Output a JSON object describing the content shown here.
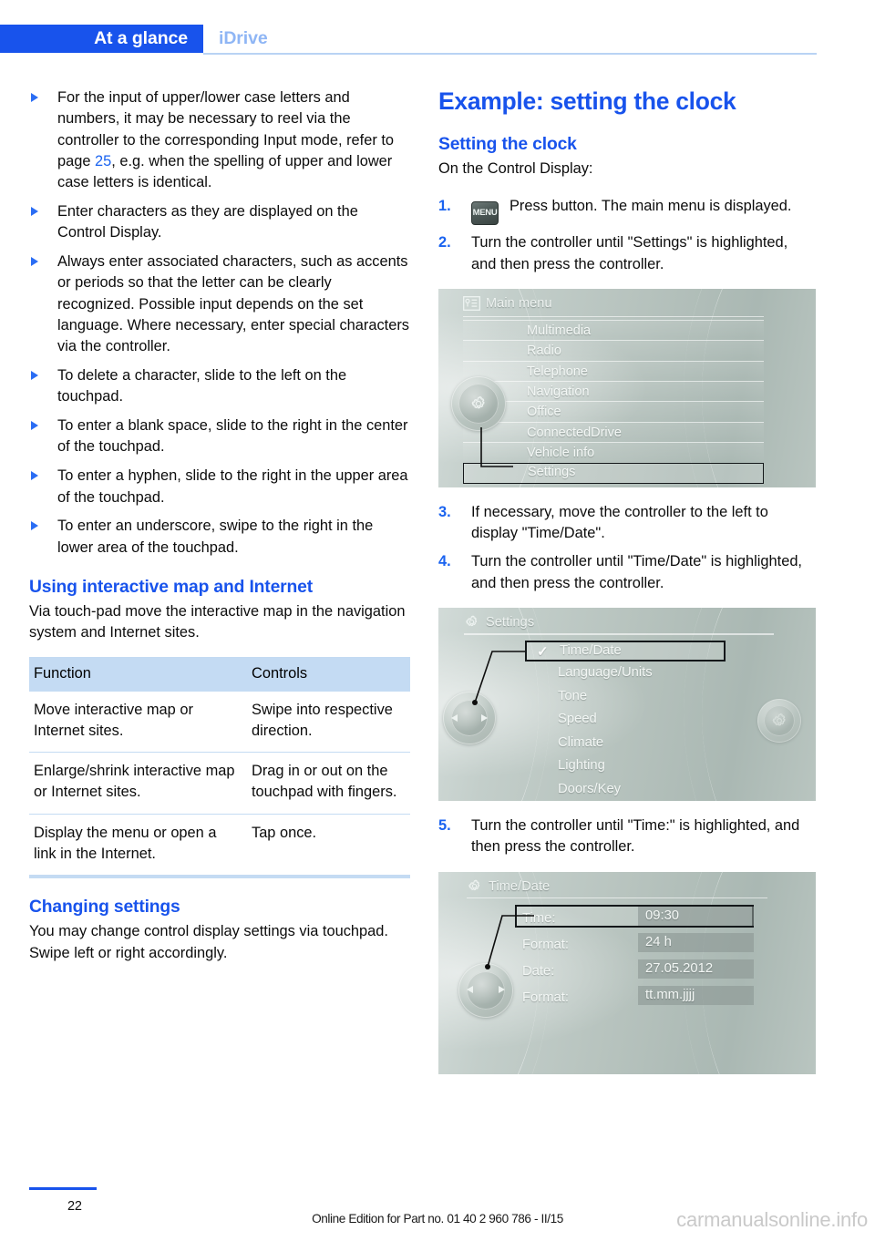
{
  "header": {
    "tab_label": "At a glance",
    "section_label": "iDrive",
    "accent_color": "#1853ec",
    "sub_color": "#8fb6f5"
  },
  "left_column": {
    "bullets": [
      {
        "text_before": "For the input of upper/lower case letters and numbers, it may be necessary to reel via the controller to the corresponding Input mode, refer to page ",
        "page_ref": "25",
        "text_after": ", e.g. when the spelling of upper and lower case letters is identical."
      },
      {
        "text_before": "Enter characters as they are displayed on the Control Display.",
        "page_ref": "",
        "text_after": ""
      },
      {
        "text_before": "Always enter associated characters, such as accents or periods so that the letter can be clearly recognized. Possible input depends on the set language. Where necessary, enter special characters via the controller.",
        "page_ref": "",
        "text_after": ""
      },
      {
        "text_before": "To delete a character, slide to the left on the touchpad.",
        "page_ref": "",
        "text_after": ""
      },
      {
        "text_before": "To enter a blank space, slide to the right in the center of the touchpad.",
        "page_ref": "",
        "text_after": ""
      },
      {
        "text_before": "To enter a hyphen, slide to the right in the upper area of the touchpad.",
        "page_ref": "",
        "text_after": ""
      },
      {
        "text_before": "To enter an underscore, swipe to the right in the lower area of the touchpad.",
        "page_ref": "",
        "text_after": ""
      }
    ],
    "section_map": {
      "heading": "Using interactive map and Internet",
      "intro": "Via touch-pad move the interactive map in the navigation system and Internet sites."
    },
    "table": {
      "columns": [
        "Function",
        "Controls"
      ],
      "rows": [
        [
          "Move interactive map or Internet sites.",
          "Swipe into respective direction."
        ],
        [
          "Enlarge/shrink interactive map or Internet sites.",
          "Drag in or out on the touchpad with fingers."
        ],
        [
          "Display the menu or open a link in the Internet.",
          "Tap once."
        ]
      ]
    },
    "section_settings": {
      "heading": "Changing settings",
      "body": "You may change control display settings via touchpad. Swipe left or right accordingly."
    }
  },
  "right_column": {
    "title": "Example: setting the clock",
    "subtitle": "Setting the clock",
    "intro": "On the Control Display:",
    "steps": [
      {
        "num": "1.",
        "icon": "MENU",
        "text": "Press button. The main menu is displayed."
      },
      {
        "num": "2.",
        "icon": "",
        "text": "Turn the controller until \"Settings\" is highlighted, and then press the controller."
      },
      {
        "num": "3.",
        "icon": "",
        "text": "If necessary, move the controller to the left to display \"Time/Date\"."
      },
      {
        "num": "4.",
        "icon": "",
        "text": "Turn the controller until \"Time/Date\" is highlighted, and then press the controller."
      },
      {
        "num": "5.",
        "icon": "",
        "text": "Turn the controller until \"Time:\" is highlighted, and then press the controller."
      }
    ],
    "screens": {
      "main_menu": {
        "title": "Main menu",
        "title_icon": "list-menu-icon",
        "items": [
          "Multimedia",
          "Radio",
          "Telephone",
          "Navigation",
          "Office",
          "ConnectedDrive",
          "Vehicle info",
          "Settings"
        ],
        "selected": "Settings",
        "knob_icon": "gear-icon"
      },
      "settings": {
        "title": "Settings",
        "title_icon": "gear-icon",
        "items": [
          "Time/Date",
          "Language/Units",
          "Tone",
          "Speed",
          "Climate",
          "Lighting",
          "Doors/Key"
        ],
        "selected": "Time/Date",
        "checkmark": "✓",
        "knob_icon": "left-right-arrows-icon",
        "side_icon": "gear-icon"
      },
      "time_date": {
        "title": "Time/Date",
        "title_icon": "gear-icon",
        "rows": [
          {
            "label": "Time:",
            "value": "09:30",
            "selected": true
          },
          {
            "label": "Format:",
            "value": "24 h",
            "selected": false
          },
          {
            "label": "Date:",
            "value": "27.05.2012",
            "selected": false
          },
          {
            "label": "Format:",
            "value": "tt.mm.jjjj",
            "selected": false
          }
        ],
        "knob_icon": "left-right-arrows-icon"
      }
    }
  },
  "footer": {
    "page_number": "22",
    "edition": "Online Edition for Part no. 01 40 2 960 786 - II/15",
    "watermark": "carmanualsonline.info"
  }
}
